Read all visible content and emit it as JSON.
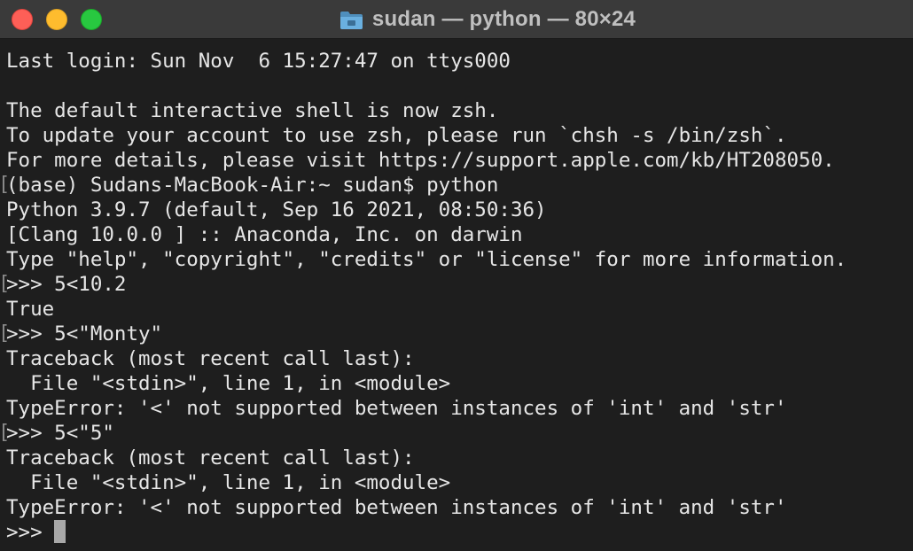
{
  "window": {
    "title": "sudan — python — 80×24",
    "traffic_lights": {
      "close": "close-button",
      "minimize": "minimize-button",
      "maximize": "maximize-button"
    },
    "colors": {
      "close": "#fe5f57",
      "minimize": "#febc2e",
      "maximize": "#28c840",
      "folder": "#5fa8d8"
    }
  },
  "terminal": {
    "lines": [
      "Last login: Sun Nov  6 15:27:47 on ttys000",
      "",
      "The default interactive shell is now zsh.",
      "To update your account to use zsh, please run `chsh -s /bin/zsh`.",
      "For more details, please visit https://support.apple.com/kb/HT208050.",
      "(base) Sudans-MacBook-Air:~ sudan$ python",
      "Python 3.9.7 (default, Sep 16 2021, 08:50:36)",
      "[Clang 10.0.0 ] :: Anaconda, Inc. on darwin",
      "Type \"help\", \"copyright\", \"credits\" or \"license\" for more information.",
      ">>> 5<10.2",
      "True",
      ">>> 5<\"Monty\"",
      "Traceback (most recent call last):",
      "  File \"<stdin>\", line 1, in <module>",
      "TypeError: '<' not supported between instances of 'int' and 'str'",
      ">>> 5<\"5\"",
      "Traceback (most recent call last):",
      "  File \"<stdin>\", line 1, in <module>",
      "TypeError: '<' not supported between instances of 'int' and 'str'"
    ],
    "prompt": ">>>"
  }
}
